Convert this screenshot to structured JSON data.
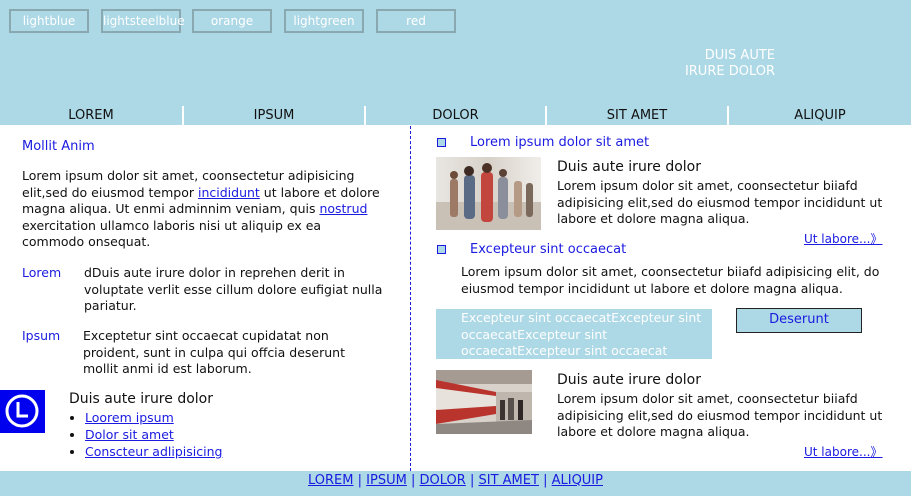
{
  "colors": {
    "header_bg": "#add8e6",
    "link": "#1a1ae0",
    "white": "#ffffff"
  },
  "swatches": [
    "lightblue",
    "lightsteelblue",
    "orange",
    "lightgreen",
    "red"
  ],
  "header": {
    "note_line1": "DUIS AUTE",
    "note_line2": "IRURE DOLOR"
  },
  "nav": [
    "LOREM",
    "IPSUM",
    "DOLOR",
    "SIT AMET",
    "ALIQUIP"
  ],
  "left": {
    "title": "Mollit Anim",
    "para_part1": "Lorem ipsum dolor sit amet, coonsectetur adipisicing elit,sed do eiusmod tempor ",
    "para_link1": "incididunt",
    "para_part2": " ut labore et dolore magna aliqua. Ut enmi adminnim veniam, quis ",
    "para_link2": "nostrud",
    "para_part3": " exercitation ullamco laboris nisi ut aliquip ex ea commodo onsequat.",
    "def1_term": "Lorem",
    "def1_text": "dDuis aute irure dolor in reprehen derit in voluptate verlit esse cillum dolore eufigiat nulla pariatur.",
    "def2_term": "Ipsum",
    "def2_text": "Exceptetur sint occaecat cupidatat non proident, sunt in culpa qui offcia deserunt mollit anmi id est laborum.",
    "list_title": "Duis aute irure dolor",
    "list_items": [
      "Loorem ipsum",
      "Dolor sit amet",
      "Conscteur adlipisicing"
    ],
    "logo_icon": "clock-icon"
  },
  "right": {
    "heading1": "Lorem ipsum dolor sit amet",
    "card1": {
      "title": "Duis aute irure dolor",
      "text": "Lorem ipsum dolor sit amet, coonsectetur biiafd adipisicing elit,sed do eiusmod tempor incididunt ut labore et dolore magna aliqua.",
      "more": "Ut labore...》"
    },
    "heading2": "Excepteur sint occaecat",
    "para2": "Lorem ipsum dolor sit amet, coonsectetur biiafd adipisicing elit, do eiusmod tempor incididunt ut labore et dolore magna aliqua.",
    "highlight": "Excepteur sint occaecatExcepteur sint occaecatExcepteur sint occaecatExcepteur sint occaecat",
    "button": "Deserunt",
    "card2": {
      "title": "Duis aute irure dolor",
      "text": "Lorem ipsum dolor sit amet, coonsectetur biiafd adipisicing elit,sed do eiusmod tempor incididunt ut labore et dolore magna aliqua.",
      "more": "Ut labore...》"
    }
  },
  "footer": {
    "links": [
      "LOREM",
      "IPSUM",
      "DOLOR",
      "SIT AMET",
      "ALIQUIP"
    ],
    "separator": "|"
  }
}
